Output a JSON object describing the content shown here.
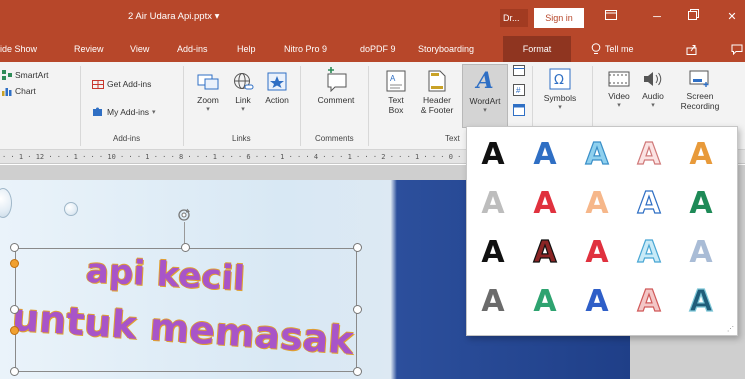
{
  "window": {
    "title": "2 Air Udara Api.pptx  ▾",
    "user_short": "Dr...",
    "sign_in": "Sign in"
  },
  "tabs": [
    "ide Show",
    "Review",
    "View",
    "Add-ins",
    "Help",
    "Nitro Pro 9",
    "doPDF 9",
    "Storyboarding",
    "Format"
  ],
  "tell_me": "Tell me",
  "ribbon": {
    "smartart": "SmartArt",
    "chart": "Chart",
    "get_addins": "Get Add-ins",
    "my_addins": "My Add-ins",
    "addins_group": "Add-ins",
    "zoom": "Zoom",
    "link": "Link",
    "action": "Action",
    "links_group": "Links",
    "comment": "Comment",
    "comments_group": "Comments",
    "text_box_1": "Text",
    "text_box_2": "Box",
    "header_1": "Header",
    "header_2": "& Footer",
    "wordart": "WordArt",
    "text_group": "Text",
    "symbols": "Symbols",
    "video": "Video",
    "audio": "Audio",
    "screen_rec_1": "Screen",
    "screen_rec_2": "Recording"
  },
  "ruler": "· · 1 · 12 · · · 1 · · · 10 · · · 1 · · · 8 · · · 1 · · · 6 · · · 1 · · · 4 · · · 1 · · · 2 · · · 1 · · · 0 · · · 1 · · · 2 · · · 1 · · · 4 · · · 1 · · · 6 · · · 1 · · · 8 · ·",
  "slide_text": {
    "line1": "api kecil",
    "line2": "untuk memasak"
  },
  "wordart_gallery": {
    "glyph": "A",
    "styles": [
      {
        "fill": "#111111",
        "stroke": "none"
      },
      {
        "fill": "#2f6fc4",
        "stroke": "none"
      },
      {
        "fill": "#8fd0ee",
        "stroke": "#3a8fc8"
      },
      {
        "fill": "#fbe3e3",
        "stroke": "#d07a7a"
      },
      {
        "fill": "#e89a3a",
        "stroke": "none"
      },
      {
        "fill": "#bdbdbd",
        "stroke": "none"
      },
      {
        "fill": "#e0313e",
        "stroke": "none"
      },
      {
        "fill": "#f6b78a",
        "stroke": "none"
      },
      {
        "fill": "#ffffff",
        "stroke": "#2f6fc4"
      },
      {
        "fill": "#1e8a57",
        "stroke": "none"
      },
      {
        "fill": "#111111",
        "stroke": "none"
      },
      {
        "fill": "#8b2525",
        "stroke": "#111111"
      },
      {
        "fill": "#e0313e",
        "stroke": "none"
      },
      {
        "fill": "#c8eaf7",
        "stroke": "#4aa7d4"
      },
      {
        "fill": "#a9bcd6",
        "stroke": "none"
      },
      {
        "fill": "#6b6b6b",
        "stroke": "none"
      },
      {
        "fill": "#2ea370",
        "stroke": "none"
      },
      {
        "fill": "#2f5fc8",
        "stroke": "none"
      },
      {
        "fill": "#f3c6c6",
        "stroke": "#d05a5a"
      },
      {
        "fill": "#1f5d7a",
        "stroke": "#7ec7d8"
      }
    ]
  },
  "colors": {
    "accent": "#b7472a",
    "tab_active": "#8f3520",
    "ribbon_bg": "#f3f3f3",
    "wordart_fill": "#a855c8",
    "wordart_outline": "#e0a030"
  }
}
